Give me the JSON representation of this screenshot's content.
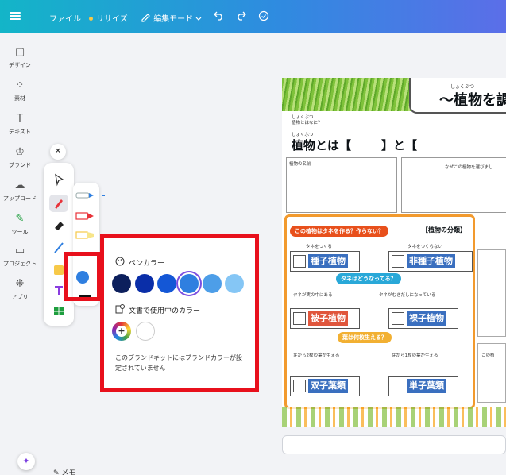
{
  "topbar": {
    "file_label": "ファイル",
    "resize_label": "リサイズ",
    "edit_mode_label": "編集モード"
  },
  "rail": {
    "items": [
      {
        "label": "デザイン",
        "icon": "layout-icon"
      },
      {
        "label": "素材",
        "icon": "shapes-icon"
      },
      {
        "label": "テキスト",
        "icon": "text-icon"
      },
      {
        "label": "ブランド",
        "icon": "brand-icon"
      },
      {
        "label": "アップロード",
        "icon": "upload-icon"
      },
      {
        "label": "ツール",
        "icon": "draw-icon"
      },
      {
        "label": "プロジェクト",
        "icon": "folder-icon"
      },
      {
        "label": "アプリ",
        "icon": "apps-icon"
      }
    ]
  },
  "popup": {
    "pen_color_heading": "ペンカラー",
    "doc_colors_heading": "文書で使用中のカラー",
    "brand_note": "このブランドキットにはブランドカラーが設定されていません",
    "pen_colors": [
      "#0c1f5c",
      "#0a2ea8",
      "#1457d6",
      "#2f7fe0",
      "#4d9ee8",
      "#85c6f5"
    ],
    "selected_color": "#2f7fe0"
  },
  "worksheet": {
    "title_ruby": "しょくぶつ",
    "title": "〜植物を調",
    "q_ruby": "しょくぶつ",
    "q_small": "植物とはなに？",
    "headline_ruby": "しょくぶつ",
    "headline": "植物とは【",
    "headline_and": "】と【",
    "name_small": "植物の名前",
    "why_small": "なぜこの植物を選びまし",
    "q1": "この植物はタネを作る？作らない？",
    "classification": "【植物の分類】",
    "makes_seed": "タネをつくる",
    "no_seed": "タネをつくらない",
    "seed_plant": "種子植物",
    "non_seed_plant": "非種子植物",
    "q2": "タネはどうなってる？",
    "seed_inside": "タネが実の中にある",
    "seed_outside": "タネがむきだしになっている",
    "angiosperm": "被子植物",
    "gymnosperm": "裸子植物",
    "q3": "葉は何枚生える？",
    "two_leaves": "芽から2枚の葉が生える",
    "one_leaf": "芽から1枚の葉が生える",
    "dicot": "双子葉類",
    "monocot": "単子葉類",
    "right_small": "この植"
  },
  "footer": {
    "memo_label": "メモ"
  },
  "colors": {
    "highlight_red": "#e8101c",
    "brand_gradient_start": "#13b5c8",
    "brand_gradient_end": "#5b6ee8"
  }
}
